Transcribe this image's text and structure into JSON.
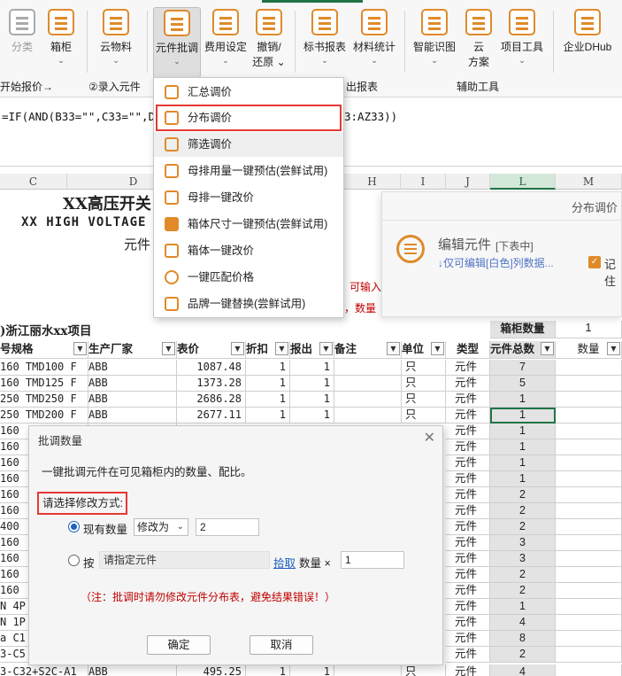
{
  "ribbon": {
    "items": [
      {
        "label": "分类",
        "sub": "",
        "disabled": true
      },
      {
        "label": "箱柜",
        "sub": "⌄"
      },
      {
        "label": "云物料",
        "sub": "⌄"
      },
      {
        "label": "元件批调",
        "sub": "⌄",
        "active": true
      },
      {
        "label": "费用设定",
        "sub": "⌄"
      },
      {
        "label": "撤销/",
        "sub": "还原 ⌄"
      },
      {
        "label": "标书报表",
        "sub": "⌄"
      },
      {
        "label": "材料统计",
        "sub": "⌄"
      },
      {
        "label": "智能识图",
        "sub": "⌄"
      },
      {
        "label": "云",
        "sub": "方案"
      },
      {
        "label": "项目工具",
        "sub": "⌄"
      },
      {
        "label": "企业DHub",
        "sub": ""
      }
    ],
    "groups": [
      "开始报价→",
      "②录入元件",
      "出报表",
      "辅助工具"
    ]
  },
  "formula": {
    "left": "=IF(AND(B33=\"\",C33=\"\",D33=",
    "right": "3:AZ33))"
  },
  "sheet": {
    "columns": [
      "C",
      "D",
      "H",
      "I",
      "J",
      "L",
      "M"
    ],
    "title_cn": "XX高压开关",
    "title_en": "XX HIGH VOLTAGE S",
    "subtitle": "元件",
    "red_hint1": "可输入",
    "red_hint2": "，数量",
    "project": ")浙江丽水xx项目",
    "cabinet_qty_label": "箱柜数量",
    "cabinet_qty_value": "1",
    "headers": [
      "号规格",
      "生产厂家",
      "表价",
      "折扣",
      "报出",
      "备注",
      "单位",
      "类型",
      "元件总数",
      "数量"
    ],
    "rows": [
      {
        "spec": "160 TMD100 F",
        "maker": "ABB",
        "price": "1087.48",
        "disc": "1",
        "out": "1",
        "unit": "只",
        "type": "元件",
        "total": "7"
      },
      {
        "spec": "160 TMD125 F",
        "maker": "ABB",
        "price": "1373.28",
        "disc": "1",
        "out": "1",
        "unit": "只",
        "type": "元件",
        "total": "5"
      },
      {
        "spec": "250 TMD250 F",
        "maker": "ABB",
        "price": "2686.28",
        "disc": "1",
        "out": "1",
        "unit": "只",
        "type": "元件",
        "total": "1"
      },
      {
        "spec": "250 TMD200 F",
        "maker": "ABB",
        "price": "2677.11",
        "disc": "1",
        "out": "1",
        "unit": "只",
        "type": "元件",
        "total": "1"
      }
    ],
    "lower_spec": [
      "160",
      "160",
      "160",
      "160",
      "160",
      "160",
      "400",
      "160",
      "160",
      "160",
      "160",
      "N 4P",
      "N 1P",
      "a C1",
      "3-C5"
    ],
    "lower_type": [
      "元件",
      "元件",
      "元件",
      "元件",
      "元件",
      "元件",
      "元件",
      "元件",
      "元件",
      "元件",
      "元件",
      "元件",
      "元件",
      "元件",
      "元件"
    ],
    "lower_total": [
      "1",
      "1",
      "1",
      "1",
      "2",
      "2",
      "2",
      "3",
      "3",
      "2",
      "2",
      "1",
      "4",
      "8",
      "2"
    ],
    "last_row": {
      "spec": "3-C32+S2C-A1",
      "maker": "ABB",
      "price": "495.25",
      "disc": "1",
      "out": "1",
      "unit": "只",
      "type": "元件",
      "total": "4"
    }
  },
  "menu": {
    "items": [
      {
        "label": "汇总调价"
      },
      {
        "label": "分布调价"
      },
      {
        "label": "筛选调价"
      },
      {
        "label": "母排用量一键预估(尝鲜试用)"
      },
      {
        "label": "母排一键改价"
      },
      {
        "label": "箱体尺寸一键预估(尝鲜试用)"
      },
      {
        "label": "箱体一键改价"
      },
      {
        "label": "一键匹配价格"
      },
      {
        "label": "品牌一键替换(尝鲜试用)"
      }
    ]
  },
  "panel": {
    "title": "分布调价",
    "main": "编辑元件",
    "sub": "[下表中]",
    "hint": "↓仅可编辑[白色]列数据...",
    "check_label": "记住"
  },
  "dialog": {
    "title": "批调数量",
    "desc": "一键批调元件在可见箱柜内的数量、配比。",
    "prompt": "请选择修改方式:",
    "opt1_label": "现有数量",
    "opt1_select": "修改为",
    "opt1_value": "2",
    "opt2_label": "按",
    "opt2_placeholder": "请指定元件",
    "pick_link": "拾取",
    "qty_label": "数量 ×",
    "qty_value": "1",
    "note": "（注：批调时请勿修改元件分布表，避免结果错误！）",
    "ok": "确定",
    "cancel": "取消"
  }
}
